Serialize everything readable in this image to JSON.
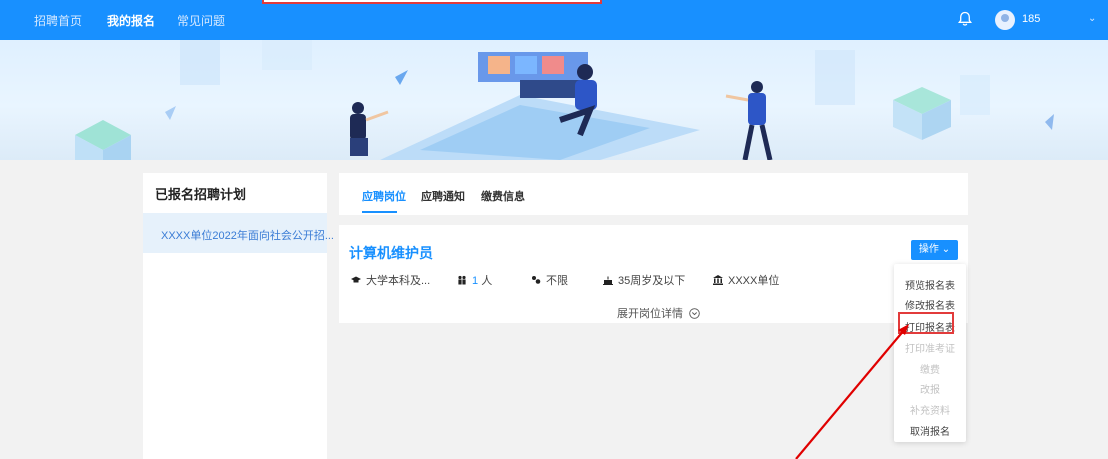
{
  "nav": {
    "items": [
      {
        "label": "招聘首页"
      },
      {
        "label": "我的报名"
      },
      {
        "label": "常见问题"
      }
    ],
    "username": "185"
  },
  "sidebar": {
    "title": "已报名招聘计划",
    "items": [
      {
        "label": "XXXX单位2022年面向社会公开招..."
      }
    ]
  },
  "tabs": [
    {
      "label": "应聘岗位"
    },
    {
      "label": "应聘通知"
    },
    {
      "label": "缴费信息"
    }
  ],
  "job": {
    "title": "计算机维护员",
    "education": "大学本科及...",
    "headcount_value": "1",
    "headcount_unit": "人",
    "gender": "不限",
    "age": "35周岁及以下",
    "unit": "XXXX单位",
    "expand_label": "展开岗位详情",
    "operation_label": "操作"
  },
  "dropdown": {
    "items": [
      {
        "label": "预览报名表"
      },
      {
        "label": "修改报名表"
      },
      {
        "label": "打印报名表"
      },
      {
        "label": "打印准考证"
      },
      {
        "label": "缴费"
      },
      {
        "label": "改报"
      },
      {
        "label": "补充资料"
      },
      {
        "label": "取消报名"
      }
    ]
  },
  "colors": {
    "primary": "#1890ff",
    "highlight": "#e23b3b",
    "disabled": "#c2c2c2"
  }
}
